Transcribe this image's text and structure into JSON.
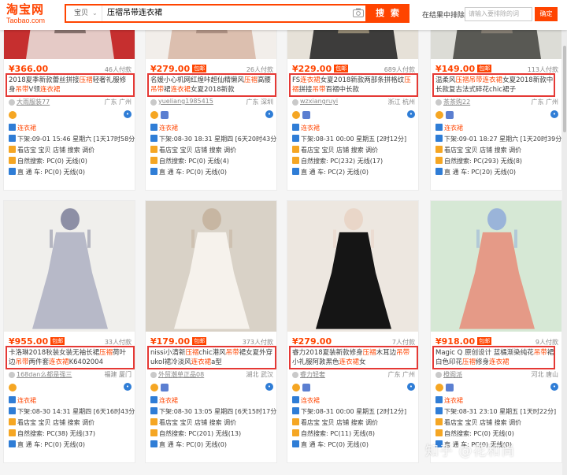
{
  "topbar": {
    "logo_cn": "淘宝网",
    "logo_en": "Taobao.com",
    "scope_label": "宝贝",
    "search_value": "压褶吊带连衣裙",
    "search_button": "搜 索",
    "exclude_label": "在结果中排除",
    "exclude_placeholder": "请输入要排除的词",
    "exclude_button": "确定"
  },
  "brand_color": "#ff4400",
  "items": [
    {
      "price": "¥366.00",
      "badge": "",
      "paid": "46人付款",
      "title_parts": [
        [
          "2018夏季新款蕾丝拼接",
          ""
        ],
        [
          "压褶",
          "hl"
        ],
        [
          "轻奢礼服修身",
          ""
        ],
        [
          "吊带",
          "hl"
        ],
        [
          "V领",
          ""
        ],
        [
          "连衣裙",
          "hl"
        ]
      ],
      "shop": "大雨服装77",
      "location": "广东 广州",
      "line1_prefix": "连衣裙",
      "line2": "下架:09-01 15:46 星期六 [1天17时58分]",
      "line3": "看店宝 宝贝 店铺 搜索 调价",
      "line4": "自然搜索: PC(0) 无线(0)",
      "line5": "直 通 车: PC(0) 无线(0)"
    },
    {
      "price": "¥279.00",
      "badge": "包邮",
      "paid": "26人付款",
      "title_parts": [
        [
          "名媛小心机网红煌咔超仙精懒风",
          ""
        ],
        [
          "压褶",
          "hl"
        ],
        [
          "高腰",
          ""
        ],
        [
          "吊带",
          "hl"
        ],
        [
          "裙",
          ""
        ],
        [
          "连衣裙",
          "hl"
        ],
        [
          "女夏2018新款",
          ""
        ]
      ],
      "shop": "yueliang1985415",
      "location": "广东 深圳",
      "line1_prefix": "连衣裙",
      "line2": "下架:08-30 18:31 星期四 [6天20时43分]",
      "line3": "看店宝 宝贝 店铺 搜索 调价",
      "line4": "自然搜索: PC(0) 无线(4)",
      "line5": "直 通 车: PC(0) 无线(0)"
    },
    {
      "price": "¥229.00",
      "badge": "包邮",
      "paid": "689人付款",
      "title_parts": [
        [
          "FS",
          ""
        ],
        [
          "连衣裙",
          "hl"
        ],
        [
          "女夏2018新款两部条拼格纹",
          ""
        ],
        [
          "压褶",
          "hl"
        ],
        [
          "拼接",
          ""
        ],
        [
          "吊带",
          "hl"
        ],
        [
          "百褶中长款",
          ""
        ]
      ],
      "shop": "wzxiangruyi",
      "location": "浙江 杭州",
      "line1_prefix": "连衣裙",
      "line2": "下架:08-31 00:00 星期五 [2时12分]",
      "line3": "看店宝 宝贝 店铺 搜索 调价",
      "line4": "自然搜索: PC(232) 无线(17)",
      "line5": "直 通 车: PC(2) 无线(0)"
    },
    {
      "price": "¥149.00",
      "badge": "包邮",
      "paid": "113人付款",
      "title_parts": [
        [
          "温柔风",
          ""
        ],
        [
          "压褶",
          "hl"
        ],
        [
          "吊带",
          "hl"
        ],
        [
          "连衣裙",
          "hl"
        ],
        [
          "女夏2018新款中长款复古法式碎花chic裙子",
          ""
        ]
      ],
      "shop": "茶茶购22",
      "location": "广东 广州",
      "line1_prefix": "连衣裙",
      "line2": "下架:09-01 18:27 星期六 [1天20时39分]",
      "line3": "看店宝 宝贝 店铺 搜索 调价",
      "line4": "自然搜索: PC(293) 无线(8)",
      "line5": "直 通 车: PC(20) 无线(0)"
    },
    {
      "price": "¥955.00",
      "badge": "包邮",
      "paid": "33人付款",
      "title_parts": [
        [
          "卡洛琳2018秋装女装无袖长裙",
          ""
        ],
        [
          "压褶",
          "hl"
        ],
        [
          "荷叶边",
          ""
        ],
        [
          "吊带",
          "hl"
        ],
        [
          "两件套",
          ""
        ],
        [
          "连衣裙",
          "hl"
        ],
        [
          "K6402004",
          ""
        ]
      ],
      "shop": "168dan么都是强三",
      "location": "福建 厦门",
      "line1_prefix": "连衣裙",
      "line2": "下架:08-30 14:31 星期四 [6天16时43分]",
      "line3": "看店宝 宝贝 店铺 搜索 调价",
      "line4": "自然搜索: PC(38) 无线(37)",
      "line5": "直 通 车: PC(0) 无线(0)"
    },
    {
      "price": "¥179.00",
      "badge": "包邮",
      "paid": "373人付款",
      "title_parts": [
        [
          "nissi小清新",
          ""
        ],
        [
          "压褶",
          "hl"
        ],
        [
          "chic港风",
          ""
        ],
        [
          "吊带",
          "hl"
        ],
        [
          "裙女夏外穿ukol裙冷淡风",
          ""
        ],
        [
          "连衣裙",
          "hl"
        ],
        [
          "a型",
          ""
        ]
      ],
      "shop": "外贸潮单正品08",
      "location": "湖北 武汉",
      "line1_prefix": "连衣裙",
      "line2": "下架:08-30 13:05 星期四 [6天15时17分]",
      "line3": "看店宝 宝贝 店铺 搜索 调价",
      "line4": "自然搜索: PC(201) 无线(13)",
      "line5": "直 通 车: PC(0) 无线(0)"
    },
    {
      "price": "¥279.00",
      "badge": "",
      "paid": "7人付款",
      "title_parts": [
        [
          "睿力2018夏装新款修身",
          ""
        ],
        [
          "压褶",
          "hl"
        ],
        [
          "木耳边",
          ""
        ],
        [
          "吊带",
          "hl"
        ],
        [
          "小礼服阿敦黑色",
          ""
        ],
        [
          "连衣裙",
          "hl"
        ],
        [
          "女",
          ""
        ]
      ],
      "shop": "睿力轻奢",
      "location": "广东 广州",
      "line1_prefix": "连衣裙",
      "line2": "下架:08-31 00:00 星期五 [2时12分]",
      "line3": "看店宝 宝贝 店铺 搜索 调价",
      "line4": "自然搜索: PC(11) 无线(8)",
      "line5": "直 通 车: PC(0) 无线(0)"
    },
    {
      "price": "¥918.00",
      "badge": "包邮",
      "paid": "9人付款",
      "title_parts": [
        [
          "Magic Q 原创设计 蓝橘渐染纯花",
          ""
        ],
        [
          "吊带",
          "hl"
        ],
        [
          "裙 白色印花",
          ""
        ],
        [
          "压褶",
          "hl"
        ],
        [
          "修身",
          ""
        ],
        [
          "连衣裙",
          "hl"
        ]
      ],
      "shop": "橙阁派",
      "location": "河北 唐山",
      "line1_prefix": "连衣裙",
      "line2": "下架:08-31 23:10 星期五 [1天时22分]",
      "line3": "看店宝 宝贝 店铺 搜索 调价",
      "line4": "自然搜索: PC(0) 无线(0)",
      "line5": "直 通 车: PC(0) 无线(0)"
    }
  ],
  "watermark": "知乎 @花和尚"
}
